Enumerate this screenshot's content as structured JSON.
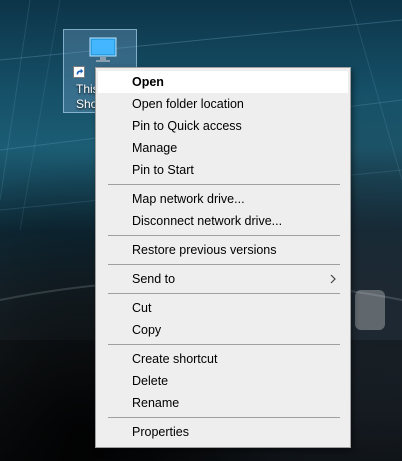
{
  "desktop": {
    "icon": {
      "name": "monitor-icon",
      "label_line1": "This",
      "label_line2": "Sho"
    }
  },
  "context_menu": {
    "groups": [
      [
        {
          "label": "Open",
          "bold": true
        },
        {
          "label": "Open folder location"
        },
        {
          "label": "Pin to Quick access"
        },
        {
          "label": "Manage"
        },
        {
          "label": "Pin to Start"
        }
      ],
      [
        {
          "label": "Map network drive..."
        },
        {
          "label": "Disconnect network drive..."
        }
      ],
      [
        {
          "label": "Restore previous versions"
        }
      ],
      [
        {
          "label": "Send to",
          "submenu": true
        }
      ],
      [
        {
          "label": "Cut"
        },
        {
          "label": "Copy"
        }
      ],
      [
        {
          "label": "Create shortcut"
        },
        {
          "label": "Delete"
        },
        {
          "label": "Rename"
        }
      ],
      [
        {
          "label": "Properties"
        }
      ]
    ]
  }
}
